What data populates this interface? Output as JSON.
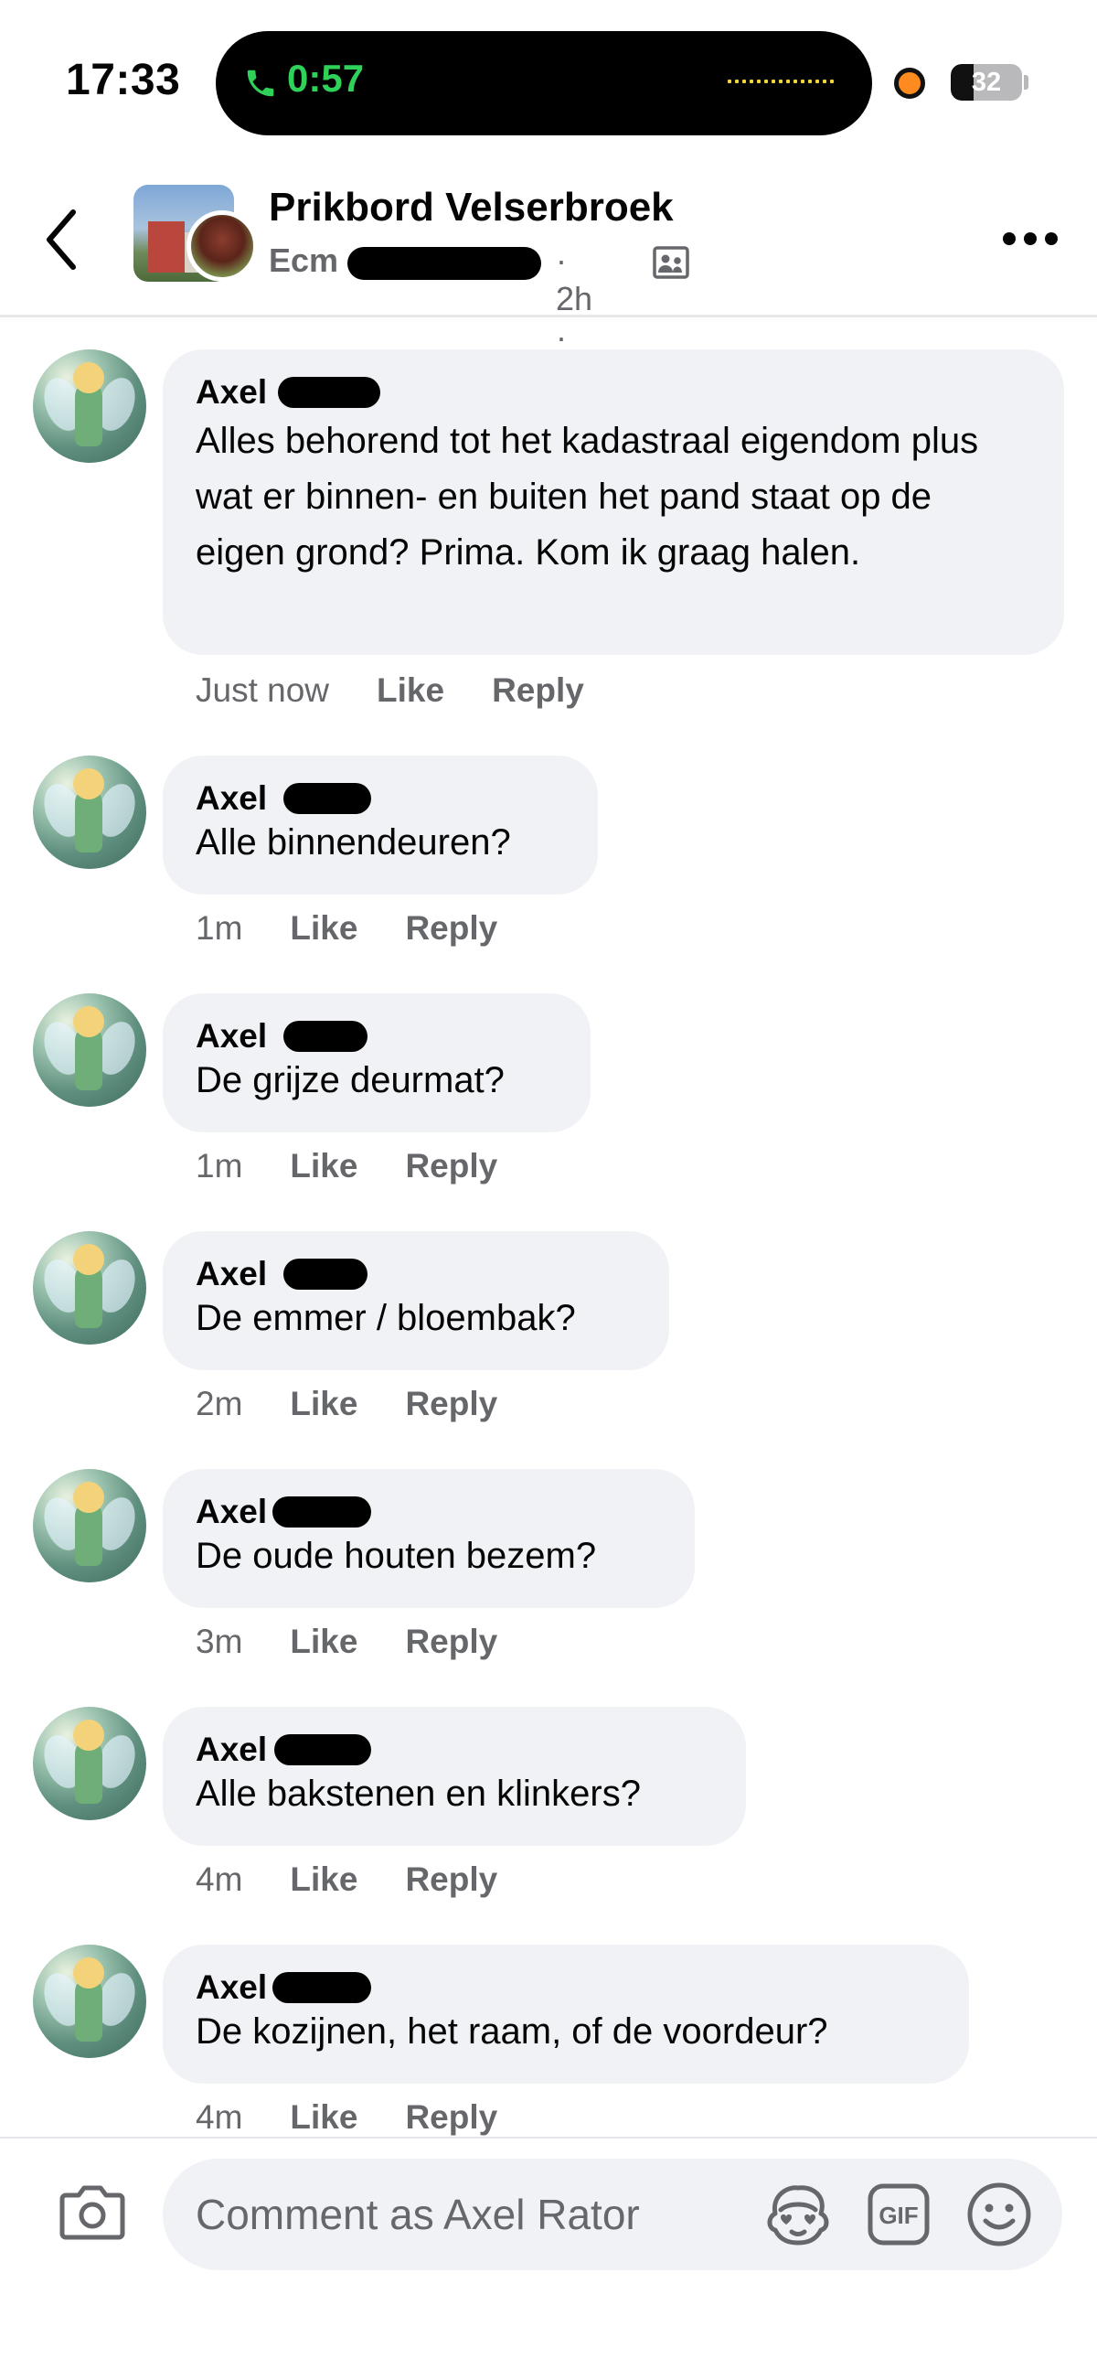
{
  "status_bar": {
    "time": "17:33",
    "call_timer": "0:57",
    "battery": "32",
    "battery_level": 0.32,
    "call_color": "#30d158",
    "recording_dot_color": "#ff8a1f"
  },
  "header": {
    "back_icon": "chevron-left-icon",
    "group_name": "Prikbord Velserbroek",
    "author_prefix": "Ecm",
    "time": "· 2h ·",
    "privacy_icon": "members-icon",
    "more_icon": "more-horizontal-icon"
  },
  "comments": [
    {
      "author": "Axel",
      "text": "Alles behorend tot het kadastraal eigendom plus wat er binnen- en buiten het pand staat op de eigen grond? Prima. Kom ik graag halen.",
      "time": "Just now",
      "like": "Like",
      "reply": "Reply"
    },
    {
      "author": "Axel",
      "text": "Alle binnendeuren?",
      "time": "1m",
      "like": "Like",
      "reply": "Reply"
    },
    {
      "author": "Axel",
      "text": "De grijze deurmat?",
      "time": "1m",
      "like": "Like",
      "reply": "Reply"
    },
    {
      "author": "Axel",
      "text": "De emmer / bloembak?",
      "time": "2m",
      "like": "Like",
      "reply": "Reply"
    },
    {
      "author": "Axel",
      "text": "De oude houten bezem?",
      "time": "3m",
      "like": "Like",
      "reply": "Reply"
    },
    {
      "author": "Axel",
      "text": "Alle bakstenen en klinkers?",
      "time": "4m",
      "like": "Like",
      "reply": "Reply"
    },
    {
      "author": "Axel",
      "text": "De kozijnen, het raam, of de voordeur?",
      "time": "4m",
      "like": "Like",
      "reply": "Reply"
    }
  ],
  "composer": {
    "placeholder": "Comment as Axel Rator",
    "camera_icon": "camera-icon",
    "avatar_sticker_icon": "avatar-sticker-icon",
    "gif_label": "GIF",
    "emoji_icon": "smiley-icon"
  },
  "colors": {
    "bubble_bg": "#f0f2f5",
    "secondary_text": "#65676b",
    "primary_text": "#050505"
  }
}
